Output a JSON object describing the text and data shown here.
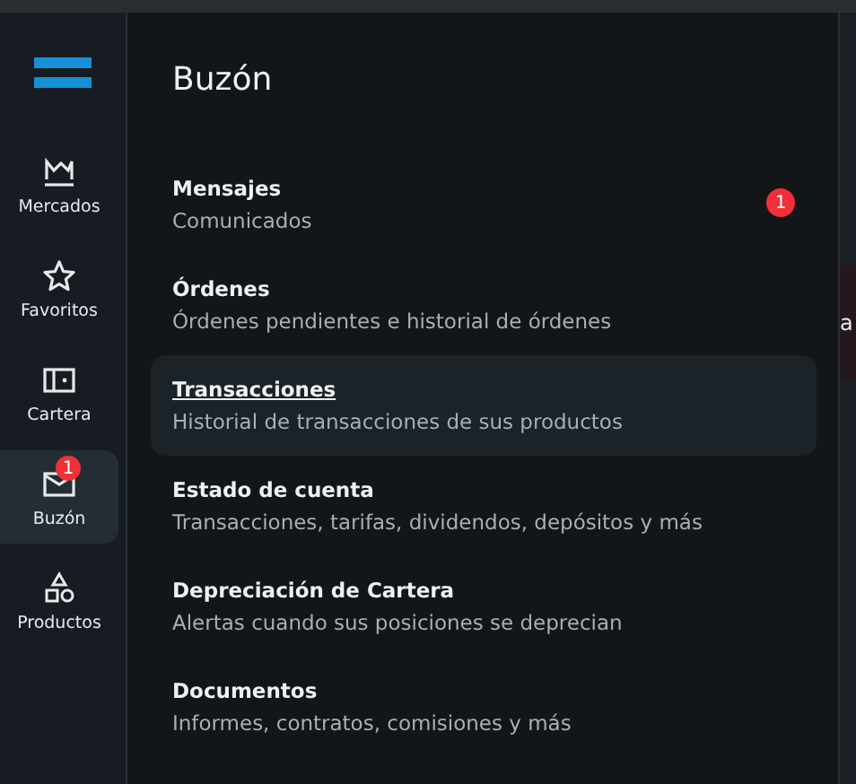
{
  "sidebar": {
    "items": [
      {
        "label": "Mercados",
        "selected": false
      },
      {
        "label": "Favoritos",
        "selected": false
      },
      {
        "label": "Cartera",
        "selected": false
      },
      {
        "label": "Buzón",
        "selected": true,
        "badge": "1"
      },
      {
        "label": "Productos",
        "selected": false
      }
    ]
  },
  "panel": {
    "title": "Buzón",
    "items": [
      {
        "title": "Mensajes",
        "subtitle": "Comunicados",
        "selected": false,
        "badge": "1"
      },
      {
        "title": "Órdenes",
        "subtitle": "Órdenes pendientes e historial de órdenes",
        "selected": false
      },
      {
        "title": "Transacciones",
        "subtitle": "Historial de transacciones de sus productos",
        "selected": true
      },
      {
        "title": "Estado de cuenta",
        "subtitle": "Transacciones, tarifas, dividendos, depósitos y más",
        "selected": false
      },
      {
        "title": "Depreciación de Cartera",
        "subtitle": "Alertas cuando sus posiciones se deprecian",
        "selected": false
      },
      {
        "title": "Documentos",
        "subtitle": "Informes, contratos, comisiones y más",
        "selected": false
      }
    ]
  },
  "background": {
    "partial_text": "a"
  }
}
